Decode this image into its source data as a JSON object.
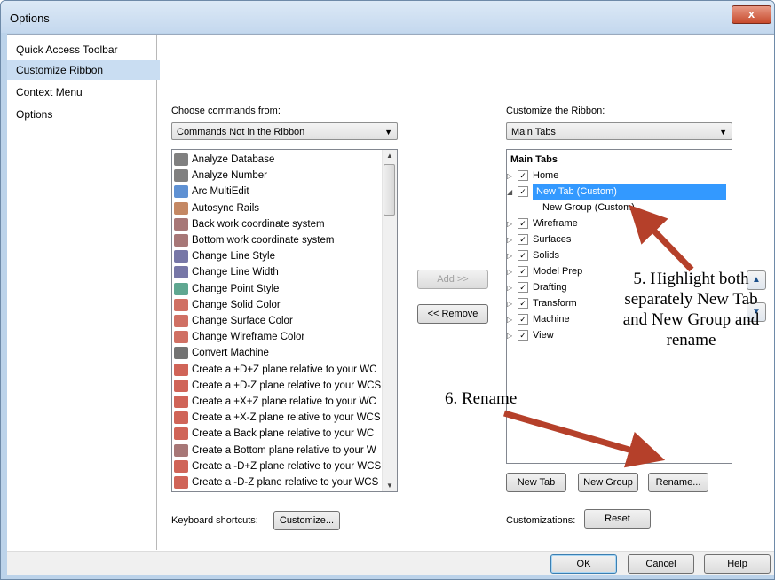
{
  "window": {
    "title": "Options",
    "close_glyph": "x"
  },
  "nav": {
    "items": [
      "Quick Access Toolbar",
      "Customize Ribbon",
      "Context Menu",
      "Options"
    ],
    "selected": "Customize Ribbon"
  },
  "left": {
    "label": "Choose commands from:",
    "combo_value": "Commands Not in the Ribbon",
    "commands": [
      "Analyze Database",
      "Analyze Number",
      "Arc MultiEdit",
      "Autosync Rails",
      "Back work coordinate system",
      "Bottom work coordinate system",
      "Change Line Style",
      "Change Line Width",
      "Change Point Style",
      "Change Solid Color",
      "Change Surface Color",
      "Change Wireframe Color",
      "Convert Machine",
      "Create a +D+Z plane relative to your WC",
      "Create a +D-Z plane relative to your WCS",
      "Create a +X+Z plane relative to your WC",
      "Create a +X-Z plane relative to your WCS",
      "Create a Back plane relative to your WC",
      "Create a Bottom plane relative to your W",
      "Create a -D+Z plane relative to your WCS",
      "Create a -D-Z plane relative to your WCS"
    ],
    "keyboard_label": "Keyboard shortcuts:",
    "customize_button": "Customize..."
  },
  "middle": {
    "add_button": "Add >>",
    "remove_button": "<< Remove"
  },
  "right": {
    "label": "Customize the Ribbon:",
    "combo_value": "Main Tabs",
    "tree_header": "Main Tabs",
    "tabs": [
      "Home",
      "New Tab (Custom)",
      "New Group (Custom)",
      "Wireframe",
      "Surfaces",
      "Solids",
      "Model Prep",
      "Drafting",
      "Transform",
      "Machine",
      "View"
    ],
    "new_tab_button": "New Tab",
    "new_group_button": "New Group",
    "rename_button": "Rename...",
    "customizations_label": "Customizations:",
    "reset_button": "Reset"
  },
  "footer": {
    "ok": "OK",
    "cancel": "Cancel",
    "help": "Help"
  },
  "annotations": {
    "step5": "5. Highlight both separately New Tab and New Group and rename",
    "step6": "6. Rename",
    "arrow_color": "#b5402a"
  },
  "colors": {
    "selection": "#3399ff",
    "nav_selection": "#c9ddf2"
  }
}
